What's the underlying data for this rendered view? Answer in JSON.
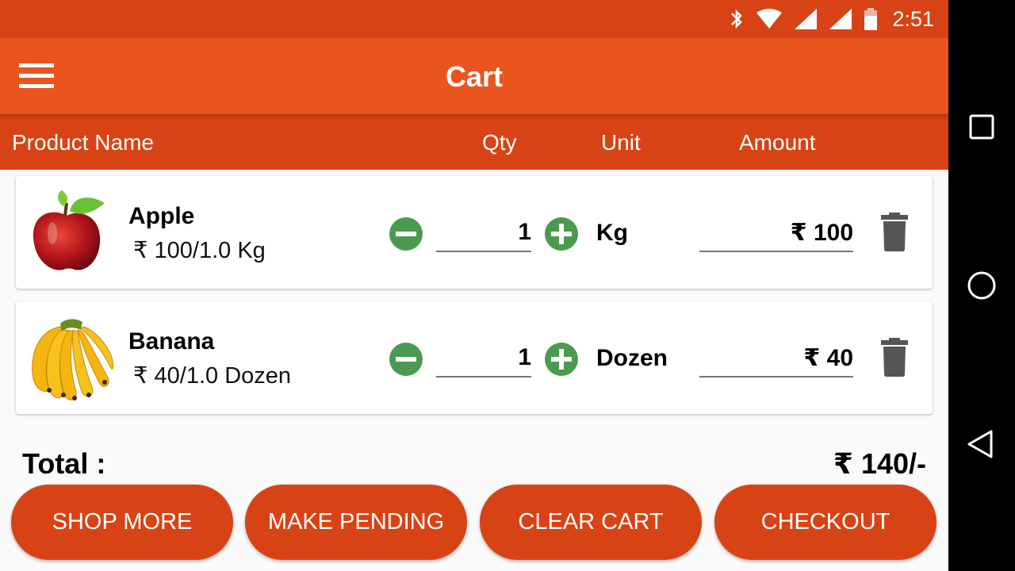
{
  "status_bar": {
    "time": "2:51",
    "icons": [
      "bluetooth-icon",
      "wifi-icon",
      "signal-icon",
      "signal-icon",
      "battery-icon"
    ],
    "color": "#d84315"
  },
  "app_bar": {
    "title": "Cart",
    "menu_icon": "hamburger-menu-icon",
    "color": "#ea551f"
  },
  "table_header": {
    "product_name": "Product Name",
    "qty": "Qty",
    "unit": "Unit",
    "amount": "Amount"
  },
  "cart_items": [
    {
      "name": "Apple",
      "rate": "₹ 100/1.0 Kg",
      "qty": "1",
      "unit": "Kg",
      "amount": "₹ 100",
      "image": "apple-image"
    },
    {
      "name": "Banana",
      "rate": "₹ 40/1.0 Dozen",
      "qty": "1",
      "unit": "Dozen",
      "amount": "₹ 40",
      "image": "banana-image"
    }
  ],
  "total": {
    "label": "Total :",
    "value": "₹ 140/-"
  },
  "actions": {
    "shop_more": "SHOP MORE",
    "make_pending": "MAKE PENDING",
    "clear_cart": "CLEAR CART",
    "checkout": "CHECKOUT"
  },
  "colors": {
    "accent": "#d84315",
    "qty_button": "#4c9a4f",
    "delete_icon": "#555555"
  },
  "nav_bar": {
    "buttons": [
      "recent-apps",
      "home",
      "back"
    ]
  }
}
